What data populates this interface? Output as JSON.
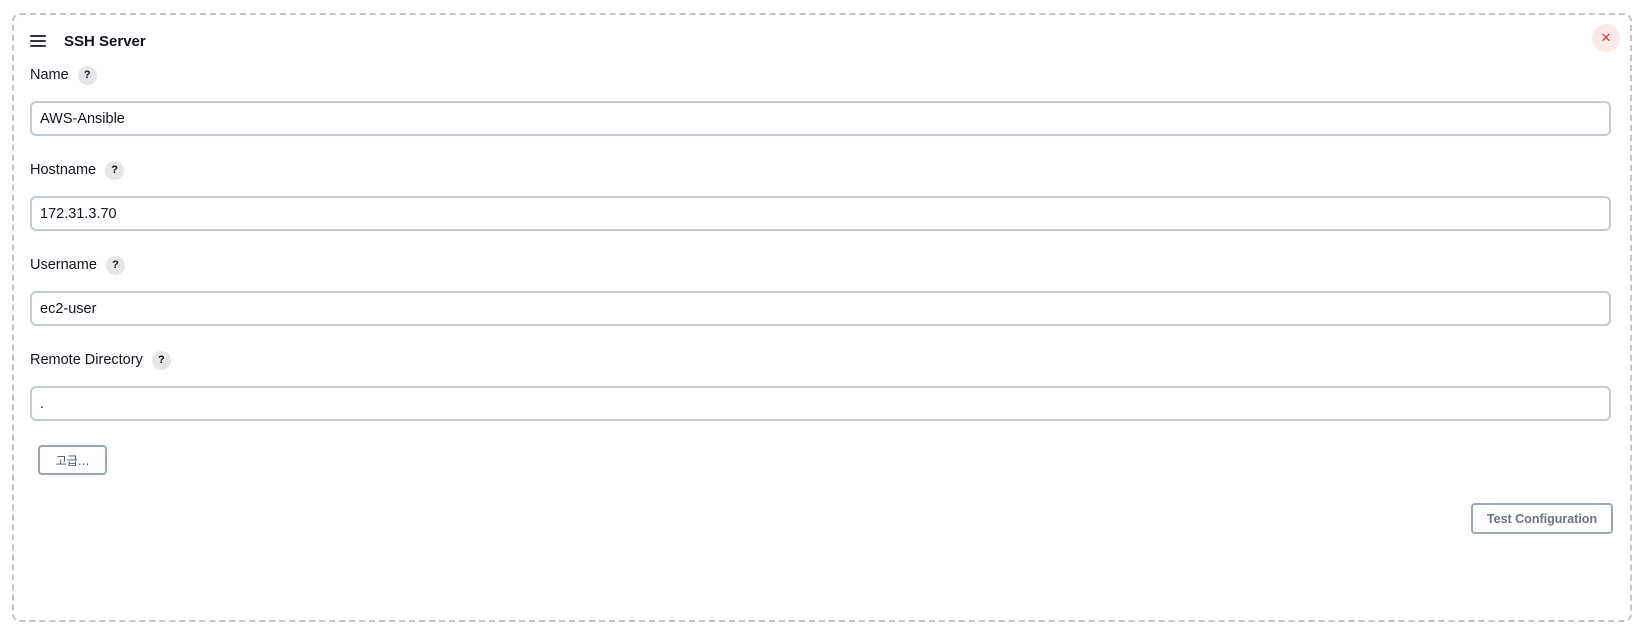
{
  "chunk": {
    "title": "SSH Server",
    "handle_icon": "hamburger-icon",
    "delete_icon": "close-icon",
    "delete_symbol": "✕",
    "delete_color": "#e03535"
  },
  "fields": {
    "name": {
      "label": "Name",
      "help": "?",
      "value": "AWS-Ansible"
    },
    "hostname": {
      "label": "Hostname",
      "help": "?",
      "value": "172.31.3.70"
    },
    "username": {
      "label": "Username",
      "help": "?",
      "value": "ec2-user"
    },
    "remote_directory": {
      "label": "Remote Directory",
      "help": "?",
      "value": "."
    }
  },
  "buttons": {
    "advanced_label": "고급...",
    "test_configuration_label": "Test Configuration"
  }
}
